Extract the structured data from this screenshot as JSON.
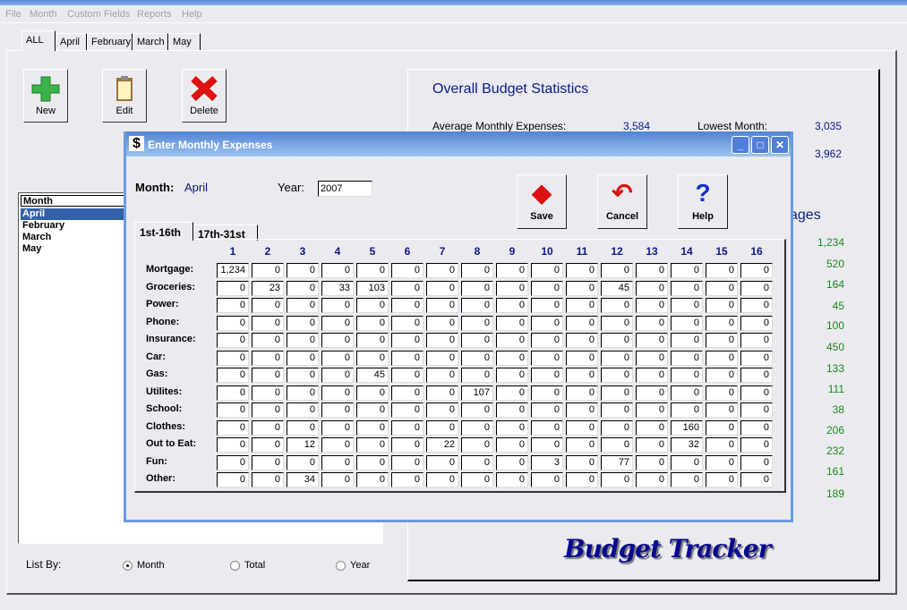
{
  "menu": [
    "File",
    "Month",
    "Custom Fields",
    "Reports",
    "Help"
  ],
  "tabs": [
    "ALL",
    "April",
    "February",
    "March",
    "May"
  ],
  "toolbar": {
    "new": "New",
    "edit": "Edit",
    "delete": "Delete"
  },
  "month_list": {
    "header": "Month",
    "items": [
      "April",
      "February",
      "March",
      "May"
    ],
    "selected": "April"
  },
  "stats": {
    "title": "Overall Budget Statistics",
    "avg_label": "Average Monthly Expenses:",
    "avg_value": "3,584",
    "lowest_label": "Lowest Month:",
    "lowest_value": "3,035",
    "highest_value": "3,962",
    "averages_title_partial": "ages",
    "averages": [
      "1,234",
      "520",
      "164",
      "45",
      "100",
      "450",
      "133",
      "111",
      "38",
      "206",
      "232",
      "161",
      "189"
    ]
  },
  "logo_text": "Budget Tracker",
  "list_by": {
    "label": "List By:",
    "options": [
      "Month",
      "Total",
      "Year"
    ],
    "selected": "Month"
  },
  "dialog": {
    "title": "Enter Monthly Expenses",
    "month_label": "Month:",
    "month_value": "April",
    "year_label": "Year:",
    "year_value": "2007",
    "save": "Save",
    "cancel": "Cancel",
    "help": "Help",
    "tabs": [
      "1st-16th",
      "17th-31st"
    ],
    "active_tab": "1st-16th",
    "columns": [
      "1",
      "2",
      "3",
      "4",
      "5",
      "6",
      "7",
      "8",
      "9",
      "10",
      "11",
      "12",
      "13",
      "14",
      "15",
      "16"
    ],
    "rows": [
      {
        "label": "Mortgage:",
        "values": [
          "1,234",
          "0",
          "0",
          "0",
          "0",
          "0",
          "0",
          "0",
          "0",
          "0",
          "0",
          "0",
          "0",
          "0",
          "0",
          "0"
        ]
      },
      {
        "label": "Groceries:",
        "values": [
          "0",
          "23",
          "0",
          "33",
          "103",
          "0",
          "0",
          "0",
          "0",
          "0",
          "0",
          "45",
          "0",
          "0",
          "0",
          "0"
        ]
      },
      {
        "label": "Power:",
        "values": [
          "0",
          "0",
          "0",
          "0",
          "0",
          "0",
          "0",
          "0",
          "0",
          "0",
          "0",
          "0",
          "0",
          "0",
          "0",
          "0"
        ]
      },
      {
        "label": "Phone:",
        "values": [
          "0",
          "0",
          "0",
          "0",
          "0",
          "0",
          "0",
          "0",
          "0",
          "0",
          "0",
          "0",
          "0",
          "0",
          "0",
          "0"
        ]
      },
      {
        "label": "Insurance:",
        "values": [
          "0",
          "0",
          "0",
          "0",
          "0",
          "0",
          "0",
          "0",
          "0",
          "0",
          "0",
          "0",
          "0",
          "0",
          "0",
          "0"
        ]
      },
      {
        "label": "Car:",
        "values": [
          "0",
          "0",
          "0",
          "0",
          "0",
          "0",
          "0",
          "0",
          "0",
          "0",
          "0",
          "0",
          "0",
          "0",
          "0",
          "0"
        ]
      },
      {
        "label": "Gas:",
        "values": [
          "0",
          "0",
          "0",
          "0",
          "45",
          "0",
          "0",
          "0",
          "0",
          "0",
          "0",
          "0",
          "0",
          "0",
          "0",
          "0"
        ]
      },
      {
        "label": "Utilites:",
        "values": [
          "0",
          "0",
          "0",
          "0",
          "0",
          "0",
          "0",
          "107",
          "0",
          "0",
          "0",
          "0",
          "0",
          "0",
          "0",
          "0"
        ]
      },
      {
        "label": "School:",
        "values": [
          "0",
          "0",
          "0",
          "0",
          "0",
          "0",
          "0",
          "0",
          "0",
          "0",
          "0",
          "0",
          "0",
          "0",
          "0",
          "0"
        ]
      },
      {
        "label": "Clothes:",
        "values": [
          "0",
          "0",
          "0",
          "0",
          "0",
          "0",
          "0",
          "0",
          "0",
          "0",
          "0",
          "0",
          "0",
          "160",
          "0",
          "0"
        ]
      },
      {
        "label": "Out to Eat:",
        "values": [
          "0",
          "0",
          "12",
          "0",
          "0",
          "0",
          "22",
          "0",
          "0",
          "0",
          "0",
          "0",
          "0",
          "32",
          "0",
          "0"
        ]
      },
      {
        "label": "Fun:",
        "values": [
          "0",
          "0",
          "0",
          "0",
          "0",
          "0",
          "0",
          "0",
          "0",
          "3",
          "0",
          "77",
          "0",
          "0",
          "0",
          "0"
        ]
      },
      {
        "label": "Other:",
        "values": [
          "0",
          "0",
          "34",
          "0",
          "0",
          "0",
          "0",
          "0",
          "0",
          "0",
          "0",
          "0",
          "0",
          "0",
          "0",
          "0"
        ]
      }
    ]
  }
}
